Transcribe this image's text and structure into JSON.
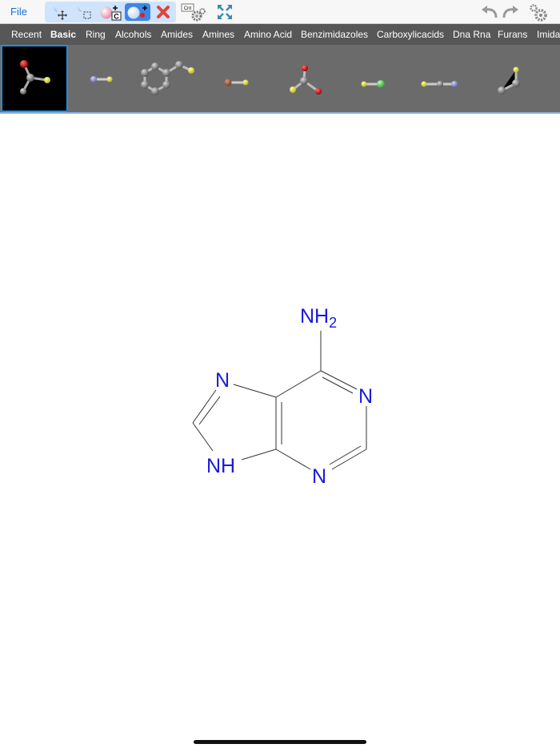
{
  "toolbar": {
    "file_label": "File",
    "tools": [
      {
        "name": "move-tool",
        "icon": "move-arrows-icon"
      },
      {
        "name": "select-tool",
        "icon": "marquee-select-icon"
      },
      {
        "name": "add-atom-tool",
        "icon": "add-atom-icon",
        "badge": "C"
      },
      {
        "name": "add-charge-tool",
        "icon": "add-charge-icon",
        "active": true
      },
      {
        "name": "delete-tool",
        "icon": "delete-x-icon"
      },
      {
        "name": "settings-cnt-tool",
        "icon": "cnt-gear-icon",
        "badge": "Cnt"
      },
      {
        "name": "fit-view-tool",
        "icon": "expand-arrows-icon"
      }
    ],
    "right_tools": [
      "undo-icon",
      "redo-icon",
      "settings-gears-icon"
    ]
  },
  "categories": [
    "Recent",
    "Basic",
    "Ring",
    "Alcohols",
    "Amides",
    "Amines",
    "Amino Acid",
    "Benzimidazoles",
    "Carboxylicacids",
    "Dna Rna",
    "Furans",
    "Imida"
  ],
  "active_category": "Basic",
  "fragments": [
    {
      "name": "fragment-carbonyl-sulfur",
      "selected": true
    },
    {
      "name": "fragment-nitrogen-sulfur"
    },
    {
      "name": "fragment-benzyl-sulfur"
    },
    {
      "name": "fragment-bromo-sulfur"
    },
    {
      "name": "fragment-sulfur-carbonyl-oxygen"
    },
    {
      "name": "fragment-sulfur-chlorine"
    },
    {
      "name": "fragment-sulfur-nitrile"
    },
    {
      "name": "fragment-ethyl-sulfur"
    }
  ],
  "molecule": {
    "atoms": {
      "amine": "NH",
      "amine_sub": "2",
      "n_imidazole_top": "N",
      "n_imidazole_bottom": "NH",
      "n_pyrimidine_right": "N",
      "n_pyrimidine_bottom": "N"
    },
    "atom_color": "#1a1adc"
  },
  "colors": {
    "accent": "#1a6fd8",
    "category_bar": "#575757",
    "fragment_bar": "#6b6b6b"
  }
}
